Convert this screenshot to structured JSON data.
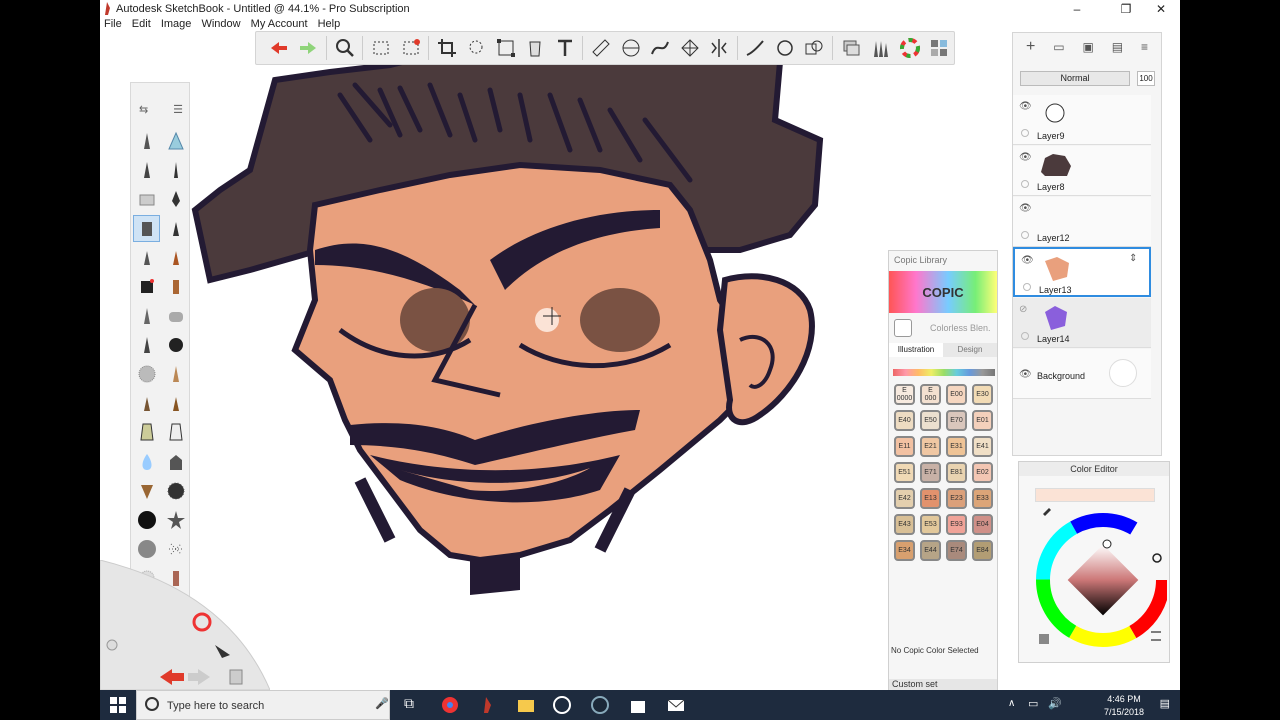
{
  "window": {
    "title": "Autodesk SketchBook - Untitled @ 44.1% - Pro Subscription",
    "minimize": "–",
    "maximize": "❐",
    "close": "✕"
  },
  "menu": [
    "File",
    "Edit",
    "Image",
    "Window",
    "My Account",
    "Help"
  ],
  "toolbar": {
    "icons": [
      "undo-icon",
      "redo-icon",
      "zoom-icon",
      "select-icon",
      "crop-select-icon",
      "crop-icon",
      "lasso-icon",
      "transform-icon",
      "fill-icon",
      "text-icon",
      "ruler-icon",
      "ellipse-guide-icon",
      "french-curve-icon",
      "perspective-icon",
      "symmetry-icon",
      "stroke-tool-icon",
      "ellipse-tool-icon",
      "copy-icon",
      "layer-editor-icon",
      "brush-library-icon",
      "color-wheel-icon",
      "copic-icon"
    ]
  },
  "layers": {
    "blend_mode": "Normal",
    "opacity": "100",
    "items": [
      {
        "name": "Layer9",
        "visible": true,
        "selected": false
      },
      {
        "name": "Layer8",
        "visible": true,
        "selected": false
      },
      {
        "name": "Layer12",
        "visible": true,
        "selected": false
      },
      {
        "name": "Layer13",
        "visible": true,
        "selected": true
      },
      {
        "name": "Layer14",
        "visible": false,
        "selected": false
      },
      {
        "name": "Background",
        "visible": true,
        "selected": false
      }
    ]
  },
  "copic": {
    "header": "Copic Library",
    "logo": "COPIC",
    "colorless": "Colorless Blen.",
    "tab_illustration": "Illustration",
    "tab_design": "Design",
    "swatches": [
      {
        "code": "E 0000",
        "color": "#f7eadf"
      },
      {
        "code": "E 000",
        "color": "#f3e0d0"
      },
      {
        "code": "E00",
        "color": "#f5d6c0"
      },
      {
        "code": "E30",
        "color": "#f2dbb5"
      },
      {
        "code": "E40",
        "color": "#eedcc2"
      },
      {
        "code": "E50",
        "color": "#ece0cf"
      },
      {
        "code": "E70",
        "color": "#d9c6bc"
      },
      {
        "code": "E01",
        "color": "#f4d0bb"
      },
      {
        "code": "E11",
        "color": "#f2c1a2"
      },
      {
        "code": "E21",
        "color": "#f0c7a3"
      },
      {
        "code": "E31",
        "color": "#eec396"
      },
      {
        "code": "E41",
        "color": "#f0dfc6"
      },
      {
        "code": "E51",
        "color": "#f0d9b5"
      },
      {
        "code": "E71",
        "color": "#c8b1a6"
      },
      {
        "code": "E81",
        "color": "#e9d3b0"
      },
      {
        "code": "E02",
        "color": "#f3c6b3"
      },
      {
        "code": "E42",
        "color": "#e3cfae"
      },
      {
        "code": "E13",
        "color": "#e2926d"
      },
      {
        "code": "E23",
        "color": "#dba07a"
      },
      {
        "code": "E33",
        "color": "#dca578"
      },
      {
        "code": "E43",
        "color": "#d8bf96"
      },
      {
        "code": "E53",
        "color": "#e2c89b"
      },
      {
        "code": "E93",
        "color": "#f0a398"
      },
      {
        "code": "E04",
        "color": "#d09088"
      },
      {
        "code": "E34",
        "color": "#d8a06f"
      },
      {
        "code": "E44",
        "color": "#b6a487"
      },
      {
        "code": "E74",
        "color": "#a98a7c"
      },
      {
        "code": "E84",
        "color": "#b29d74"
      }
    ],
    "status": "No Copic Color Selected",
    "custom_set": "Custom set"
  },
  "color_editor": {
    "title": "Color Editor",
    "current_color": "#fbe3d6"
  },
  "taskbar": {
    "search_placeholder": "Type here to search",
    "time": "4:46 PM",
    "date": "7/15/2018"
  },
  "colors": {
    "skin": "#e9a07d",
    "hair": "#4b3a3c",
    "outline": "#231a33",
    "eye": "#7a5243",
    "accent": "#2f8ce0"
  }
}
